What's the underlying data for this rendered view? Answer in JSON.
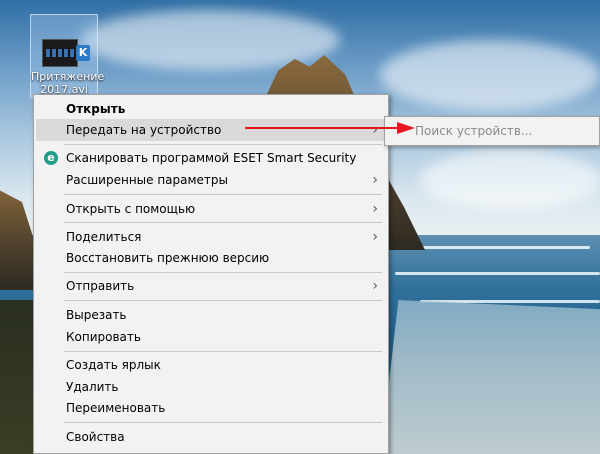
{
  "desktop": {
    "file_icon": {
      "label": "Притяжение 2017.avi",
      "badge": "K"
    }
  },
  "context_menu": {
    "items": [
      {
        "label": "Открыть"
      },
      {
        "label": "Передать на устройство"
      },
      {
        "label": "Сканировать программой ESET Smart Security",
        "icon_letter": "e"
      },
      {
        "label": "Расширенные параметры"
      },
      {
        "label": "Открыть с помощью"
      },
      {
        "label": "Поделиться"
      },
      {
        "label": "Восстановить прежнюю версию"
      },
      {
        "label": "Отправить"
      },
      {
        "label": "Вырезать"
      },
      {
        "label": "Копировать"
      },
      {
        "label": "Создать ярлык"
      },
      {
        "label": "Удалить"
      },
      {
        "label": "Переименовать"
      },
      {
        "label": "Свойства"
      }
    ],
    "submenu_arrow": "›"
  },
  "submenu": {
    "item": "Поиск устройств..."
  },
  "colors": {
    "menu_bg": "#f2f2f2",
    "hover_bg": "#d9d9d9",
    "annotation_arrow": "#e8141e",
    "eset_icon": "#1f9e8a"
  }
}
